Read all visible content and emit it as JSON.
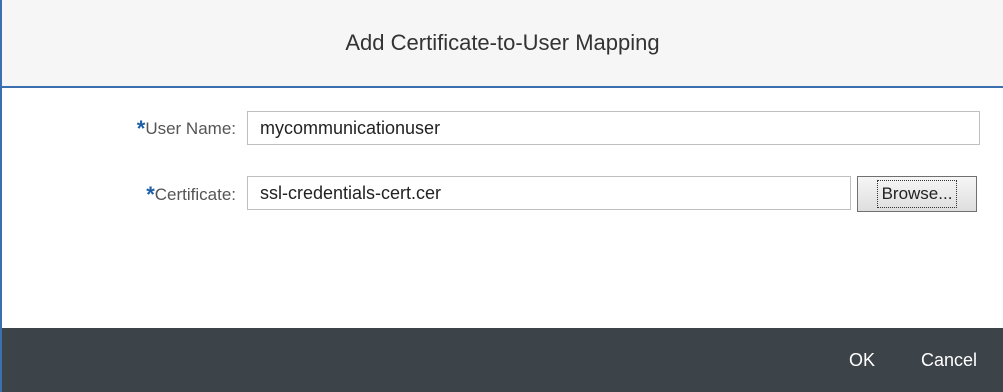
{
  "dialog": {
    "title": "Add Certificate-to-User Mapping"
  },
  "form": {
    "required_marker": "*",
    "user_name": {
      "label": "User Name:",
      "value": "mycommunicationuser"
    },
    "certificate": {
      "label": "Certificate:",
      "value": "ssl-credentials-cert.cer",
      "browse_label": "Browse..."
    }
  },
  "footer": {
    "ok_label": "OK",
    "cancel_label": "Cancel"
  },
  "colors": {
    "accent_border": "#3a6fb0",
    "required_marker": "#1c5ea8",
    "footer_bg": "#3c4349"
  }
}
